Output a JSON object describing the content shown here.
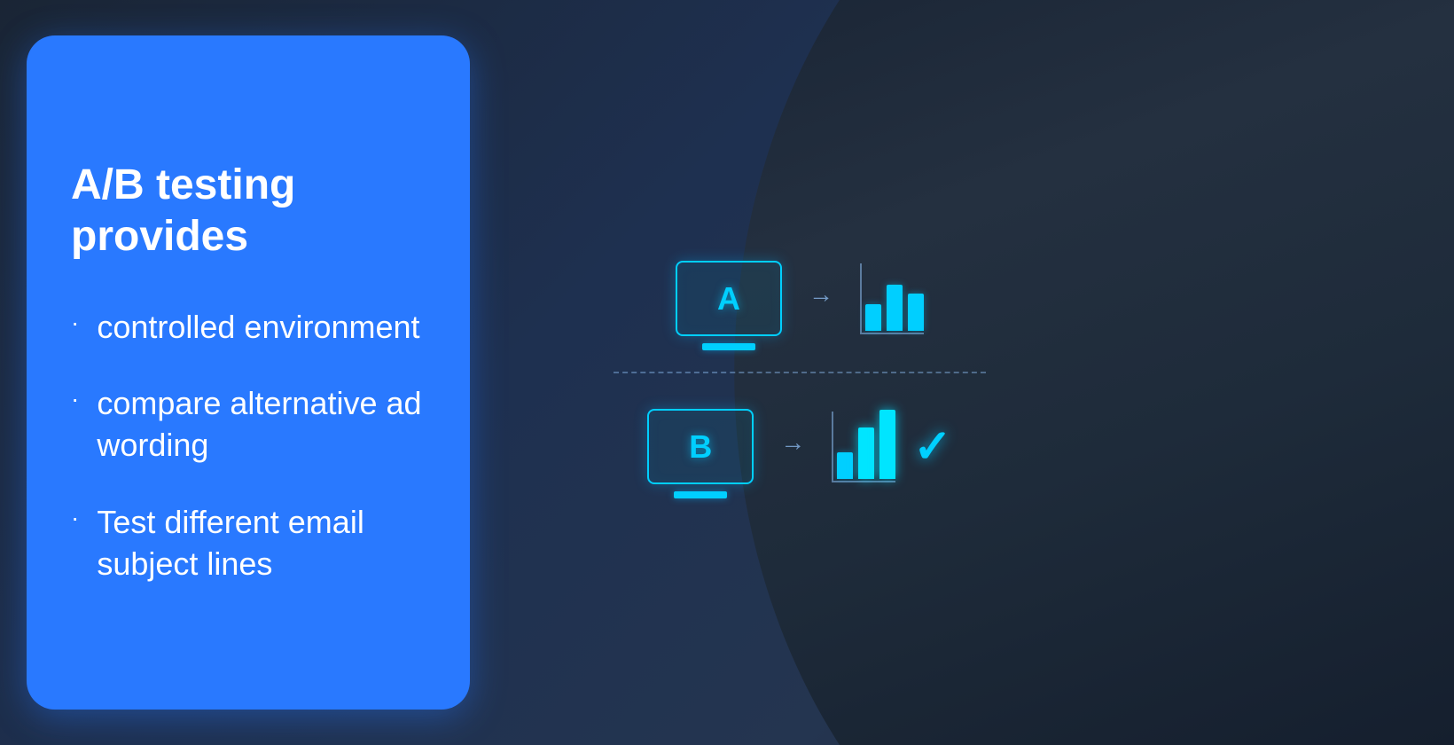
{
  "panel": {
    "title": "A/B testing provides",
    "bullets": [
      {
        "id": "bullet-1",
        "text": "controlled environment"
      },
      {
        "id": "bullet-2",
        "text": "compare alternative ad wording"
      },
      {
        "id": "bullet-3",
        "text": "Test different email subject lines"
      }
    ],
    "bullet_dot": "·"
  },
  "diagram": {
    "variant_a_label": "A",
    "variant_b_label": "B",
    "bar_a": [
      30,
      55,
      45
    ],
    "bar_b": [
      30,
      60,
      85
    ],
    "checkmark": "✓"
  },
  "colors": {
    "accent_blue": "#2979ff",
    "cyan": "#00cfff",
    "white": "#ffffff"
  }
}
